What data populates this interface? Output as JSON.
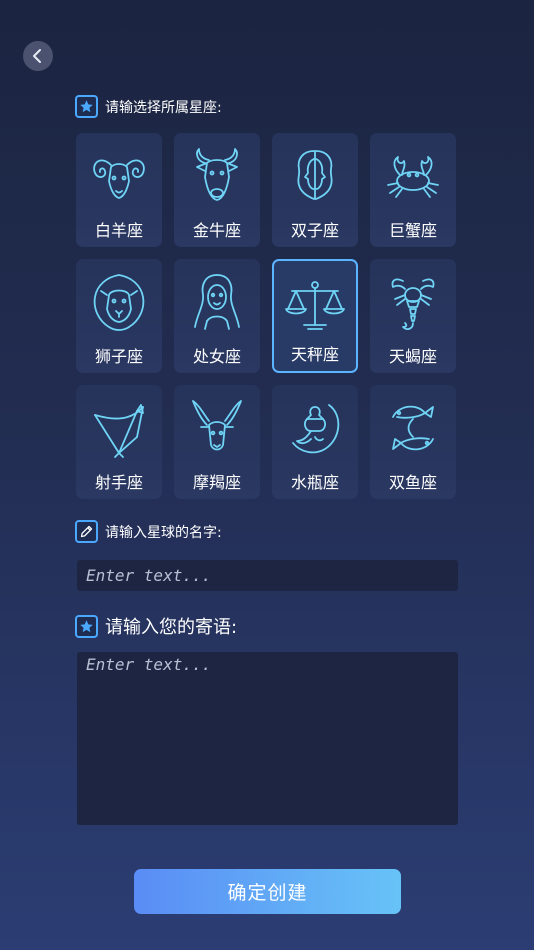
{
  "zodiac_section": {
    "title": "请输选择所属星座:"
  },
  "zodiac_signs": [
    {
      "label": "白羊座",
      "icon": "aries-ram-icon"
    },
    {
      "label": "金牛座",
      "icon": "taurus-bull-icon"
    },
    {
      "label": "双子座",
      "icon": "gemini-twins-icon"
    },
    {
      "label": "巨蟹座",
      "icon": "cancer-crab-icon"
    },
    {
      "label": "狮子座",
      "icon": "leo-lion-icon"
    },
    {
      "label": "处女座",
      "icon": "virgo-maiden-icon"
    },
    {
      "label": "天秤座",
      "icon": "libra-scales-icon",
      "selected": true
    },
    {
      "label": "天蝎座",
      "icon": "scorpio-scorpion-icon"
    },
    {
      "label": "射手座",
      "icon": "sagittarius-bow-icon"
    },
    {
      "label": "摩羯座",
      "icon": "capricorn-goat-icon"
    },
    {
      "label": "水瓶座",
      "icon": "aquarius-water-icon"
    },
    {
      "label": "双鱼座",
      "icon": "pisces-fish-icon"
    }
  ],
  "planet_name": {
    "title": "请输入星球的名字:",
    "placeholder": "Enter text..."
  },
  "message": {
    "title": "请输入您的寄语:",
    "placeholder": "Enter text..."
  },
  "confirm_label": "确定创建",
  "colors": {
    "accent": "#4aa8ff",
    "icon": "#6fd4f5",
    "selected_border": "#5ab4ff"
  }
}
